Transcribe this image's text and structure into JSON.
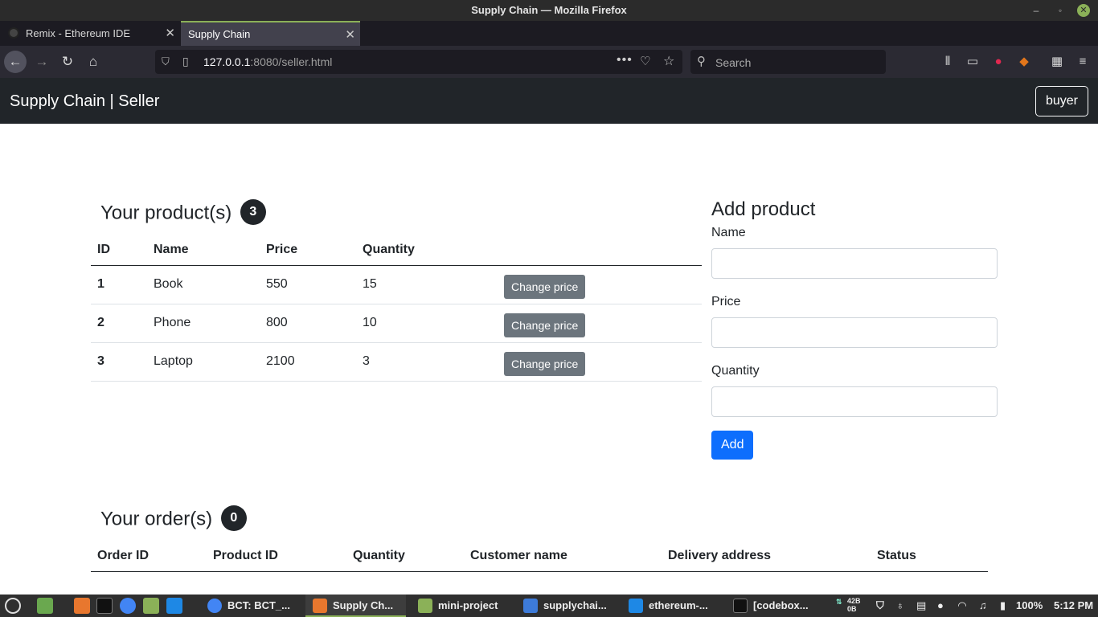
{
  "window": {
    "title": "Supply Chain — Mozilla Firefox"
  },
  "tabs": [
    {
      "label": "Remix - Ethereum IDE"
    },
    {
      "label": "Supply Chain"
    }
  ],
  "nav": {
    "url_host": "127.0.0.1",
    "url_rest": ":8080/seller.html",
    "search_placeholder": "Search"
  },
  "app": {
    "brand": "Supply Chain | Seller",
    "buyer_button": "buyer",
    "products_title": "Your product(s)",
    "products_count": "3",
    "products_headers": [
      "ID",
      "Name",
      "Price",
      "Quantity"
    ],
    "products": [
      {
        "id": "1",
        "name": "Book",
        "price": "550",
        "quantity": "15",
        "action": "Change price"
      },
      {
        "id": "2",
        "name": "Phone",
        "price": "800",
        "quantity": "10",
        "action": "Change price"
      },
      {
        "id": "3",
        "name": "Laptop",
        "price": "2100",
        "quantity": "3",
        "action": "Change price"
      }
    ],
    "add_product": {
      "title": "Add product",
      "name_label": "Name",
      "price_label": "Price",
      "quantity_label": "Quantity",
      "add_button": "Add"
    },
    "orders_title": "Your order(s)",
    "orders_count": "0",
    "orders_headers": [
      "Order ID",
      "Product ID",
      "Quantity",
      "Customer name",
      "Delivery address",
      "Status"
    ]
  },
  "taskbar": {
    "tasks": [
      {
        "label": "BCT: BCT_..."
      },
      {
        "label": "Supply Ch..."
      },
      {
        "label": "mini-project"
      },
      {
        "label": "supplychai..."
      },
      {
        "label": "ethereum-..."
      },
      {
        "label": "[codebox..."
      }
    ],
    "net_up": "42B",
    "net_down": "0B",
    "battery": "100%",
    "clock": "5:12 PM"
  },
  "colors": {
    "navbar": "#212529",
    "primary": "#0d6efd",
    "secondary": "#6c757d",
    "mint_accent": "#8bb158"
  }
}
